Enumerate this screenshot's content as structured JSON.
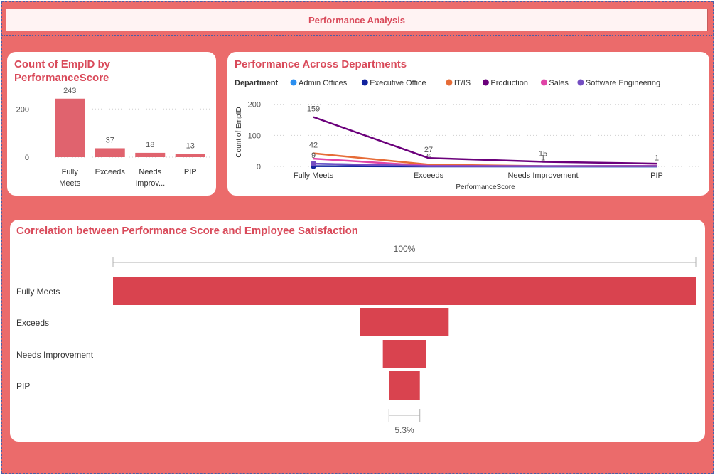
{
  "header": {
    "title": "Performance Analysis"
  },
  "chart_data": [
    {
      "type": "bar",
      "title": "Count of EmpID by PerformanceScore",
      "categories": [
        "Fully Meets",
        "Exceeds",
        "Needs Improv...",
        "PIP"
      ],
      "category_lines": [
        [
          "Fully",
          "Meets"
        ],
        [
          "Exceeds"
        ],
        [
          "Needs",
          "Improv..."
        ],
        [
          "PIP"
        ]
      ],
      "values": [
        243,
        37,
        18,
        13
      ],
      "yticks": [
        0,
        200
      ],
      "ylim": [
        0,
        260
      ],
      "color": "#e0636e"
    },
    {
      "type": "line",
      "title": "Performance Across Departments",
      "legend_title": "Department",
      "xlabel": "PerformanceScore",
      "ylabel": "Count of EmpID",
      "categories": [
        "Fully Meets",
        "Exceeds",
        "Needs Improvement",
        "PIP"
      ],
      "yticks": [
        0,
        100,
        200
      ],
      "ylim": [
        0,
        220
      ],
      "series": [
        {
          "name": "Admin Offices",
          "color": "#2b8ff0",
          "values": [
            9,
            1,
            0,
            0
          ],
          "labels": [
            null,
            null,
            null,
            null
          ]
        },
        {
          "name": "Executive Office",
          "color": "#12239e",
          "values": [
            1,
            0,
            0,
            0
          ],
          "labels": [
            null,
            null,
            null,
            null
          ]
        },
        {
          "name": "IT/IS",
          "color": "#e66c37",
          "values": [
            42,
            6,
            1,
            1
          ],
          "labels": [
            "42",
            "6",
            "1",
            null
          ]
        },
        {
          "name": "Production",
          "color": "#6b007b",
          "values": [
            159,
            27,
            15,
            9
          ],
          "labels": [
            "159",
            "27",
            "15",
            null
          ]
        },
        {
          "name": "Sales",
          "color": "#e044a7",
          "values": [
            25,
            2,
            1,
            2
          ],
          "labels": [
            null,
            null,
            null,
            null
          ]
        },
        {
          "name": "Software Engineering",
          "color": "#744ec2",
          "values": [
            9,
            1,
            1,
            1
          ],
          "labels": [
            "9",
            null,
            null,
            "1"
          ]
        }
      ]
    },
    {
      "type": "funnel",
      "title": "Correlation between Performance Score and Employee Satisfaction",
      "categories": [
        "Fully Meets",
        "Exceeds",
        "Needs Improvement",
        "PIP"
      ],
      "values": [
        100,
        15.2,
        7.4,
        5.3
      ],
      "value_unit": "%",
      "top_label": "100%",
      "bottom_label": "5.3%",
      "color": "#d9434f"
    }
  ]
}
